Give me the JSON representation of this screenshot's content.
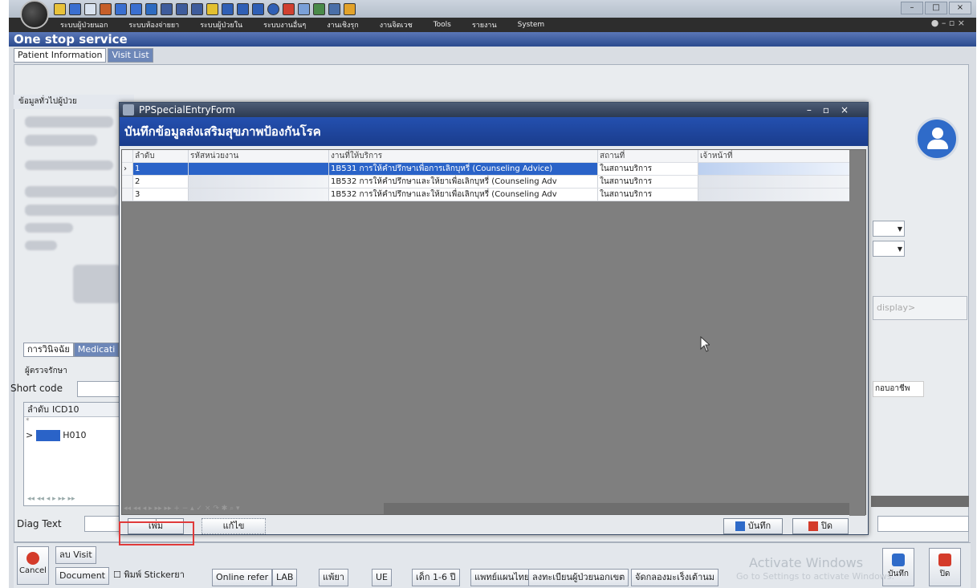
{
  "app": {
    "title": "One stop service",
    "menu": [
      "ระบบผู้ป่วยนอก",
      "ระบบห้องจ่ายยา",
      "ระบบผู้ป่วยใน",
      "ระบบงานอื่นๆ",
      "งานเชิงรุก",
      "งานจิตเวช",
      "Tools",
      "รายงาน",
      "System"
    ]
  },
  "tabs": {
    "patient": "Patient Information",
    "visit": "Visit List"
  },
  "left": {
    "section": "ข้อมูลทั่วไปผู้ป่วย",
    "tab_diag": "การวินิจฉัย",
    "tab_med": "Medicati",
    "doctor": "ผู้ตรวจรักษา",
    "short_code": "Short code",
    "grid_order": "ลำดับ",
    "grid_icd": "ICD10",
    "icd_value": "H010",
    "diag_text": "Diag Text"
  },
  "right": {
    "display": "display>",
    "occupation": "กอบอาชีพ"
  },
  "dialog": {
    "title": "PPSpecialEntryForm",
    "header": "บันทึกข้อมูลส่งเสริมสุขภาพป้องกันโรค",
    "columns": [
      "ลำดับ",
      "รหัสหน่วยงาน",
      "งานที่ให้บริการ",
      "สถานที่",
      "เจ้าหน้าที่"
    ],
    "rows": [
      {
        "no": "1",
        "service": "1B531 การให้คำปรึกษาเพื่อการเลิกบุหรี่ (Counseling Advice)",
        "place": "ในสถานบริการ"
      },
      {
        "no": "2",
        "service": "1B532 การให้คำปรึกษาและให้ยาเพื่อเลิกบุหรี่ (Counseling Adv",
        "place": "ในสถานบริการ"
      },
      {
        "no": "3",
        "service": "1B532 การให้คำปรึกษาและให้ยาเพื่อเลิกบุหรี่ (Counseling Adv",
        "place": "ในสถานบริการ"
      }
    ],
    "add": "เพิ่ม",
    "edit": "แก้ไข",
    "save": "บันทึก",
    "close": "ปิด"
  },
  "bottom": {
    "cancel": "Cancel",
    "visit": "ลบ Visit",
    "document": "Document",
    "sticker": "พิมพ์ Stickerยา",
    "online": "Online refer",
    "lab": "LAB",
    "drug": "แพ้ยา",
    "ue": "UE",
    "child": "เด็ก 1-6 ปี",
    "thai": "แพทย์แผนไทย",
    "reg": "ลงทะเบียนผู้ป่วยนอกเขต",
    "chronic": "จัดกลองมะเร็งเต้านม",
    "save": "บันทึก",
    "close": "ปิด",
    "wm1": "Activate Windows",
    "wm2": "Go to Settings to activate Windows."
  },
  "colors": {
    "accent": "#2450b0",
    "highlight": "#e03a3a"
  }
}
